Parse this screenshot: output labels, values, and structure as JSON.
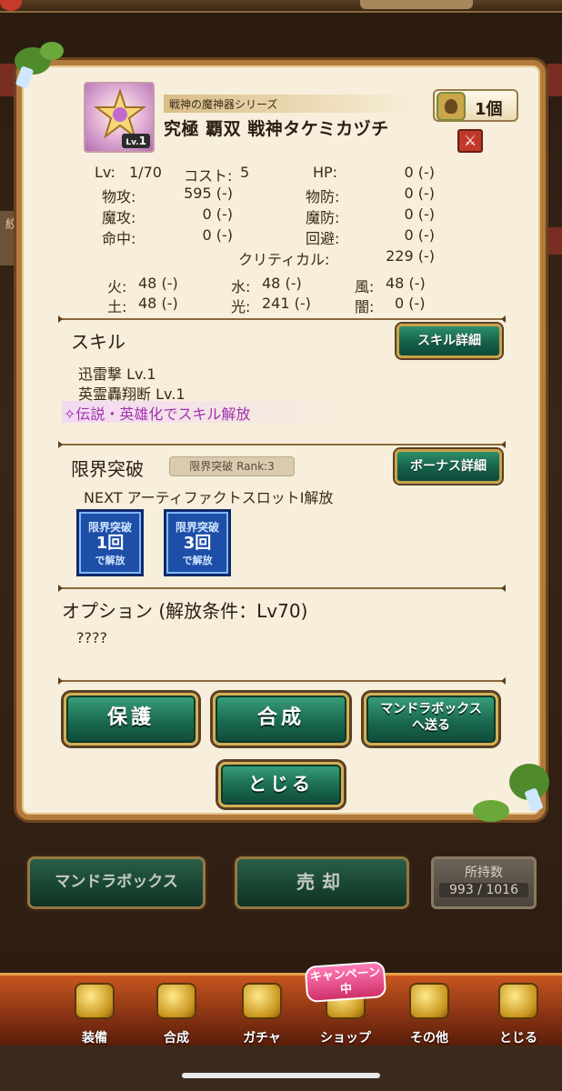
{
  "item": {
    "series": "戦神の魔神器シリーズ",
    "name": "究極 覇双 戦神タケミカヅチ",
    "level_badge": "1",
    "level_badge_prefix": "Lv.",
    "count": "1個",
    "attribute_icon": "fire-weapon-icon"
  },
  "stats": {
    "lv_label": "Lv:",
    "lv_value": "1/70",
    "cost_label": "コスト:",
    "cost_value": "5",
    "hp_label": "HP:",
    "hp_value": "0 (-)",
    "patk_label": "物攻:",
    "patk_value": "595 (-)",
    "pdef_label": "物防:",
    "pdef_value": "0 (-)",
    "matk_label": "魔攻:",
    "matk_value": "0 (-)",
    "mdef_label": "魔防:",
    "mdef_value": "0 (-)",
    "hit_label": "命中:",
    "hit_value": "0 (-)",
    "eva_label": "回避:",
    "eva_value": "0 (-)",
    "crit_label": "クリティカル:",
    "crit_value": "229 (-)"
  },
  "elements": {
    "fire_label": "火:",
    "fire_value": "48 (-)",
    "water_label": "水:",
    "water_value": "48 (-)",
    "wind_label": "風:",
    "wind_value": "48 (-)",
    "earth_label": "土:",
    "earth_value": "48 (-)",
    "light_label": "光:",
    "light_value": "241 (-)",
    "dark_label": "闇:",
    "dark_value": "0 (-)"
  },
  "skill": {
    "title": "スキル",
    "detail_button": "スキル詳細",
    "skills": [
      "迅雷撃 Lv.1",
      "英霊轟翔断 Lv.1"
    ],
    "unlock_note": "✧伝説・英雄化でスキル解放"
  },
  "limit_break": {
    "title": "限界突破",
    "rank": "限界突破 Rank:3",
    "bonus_button": "ボーナス詳細",
    "next": "NEXT アーティファクトスロットⅠ解放",
    "badges": [
      {
        "line1": "限界突破",
        "line2": "1回",
        "line3": "で解放"
      },
      {
        "line1": "限界突破",
        "line2": "3回",
        "line3": "で解放"
      }
    ]
  },
  "option": {
    "title": "オプション (解放条件：Lv70)",
    "value": "????"
  },
  "actions": {
    "protect": "保護",
    "combine": "合成",
    "send_line1": "マンドラボックス",
    "send_line2": "へ送る",
    "close": "とじる"
  },
  "under": {
    "mandra": "マンドラボックス",
    "sell": "売却",
    "owned_label": "所持数",
    "owned_value": "993 / 1016",
    "side_label": "絞"
  },
  "nav": {
    "campaign": "キャンペーン中",
    "items": [
      {
        "label": "装備",
        "icon": "equipment-icon"
      },
      {
        "label": "合成",
        "icon": "hammer-icon"
      },
      {
        "label": "ガチャ",
        "icon": "gacha-icon"
      },
      {
        "label": "ショップ",
        "icon": "shop-icon"
      },
      {
        "label": "その他",
        "icon": "gear-icon"
      },
      {
        "label": "とじる",
        "icon": "close-icon"
      }
    ]
  }
}
